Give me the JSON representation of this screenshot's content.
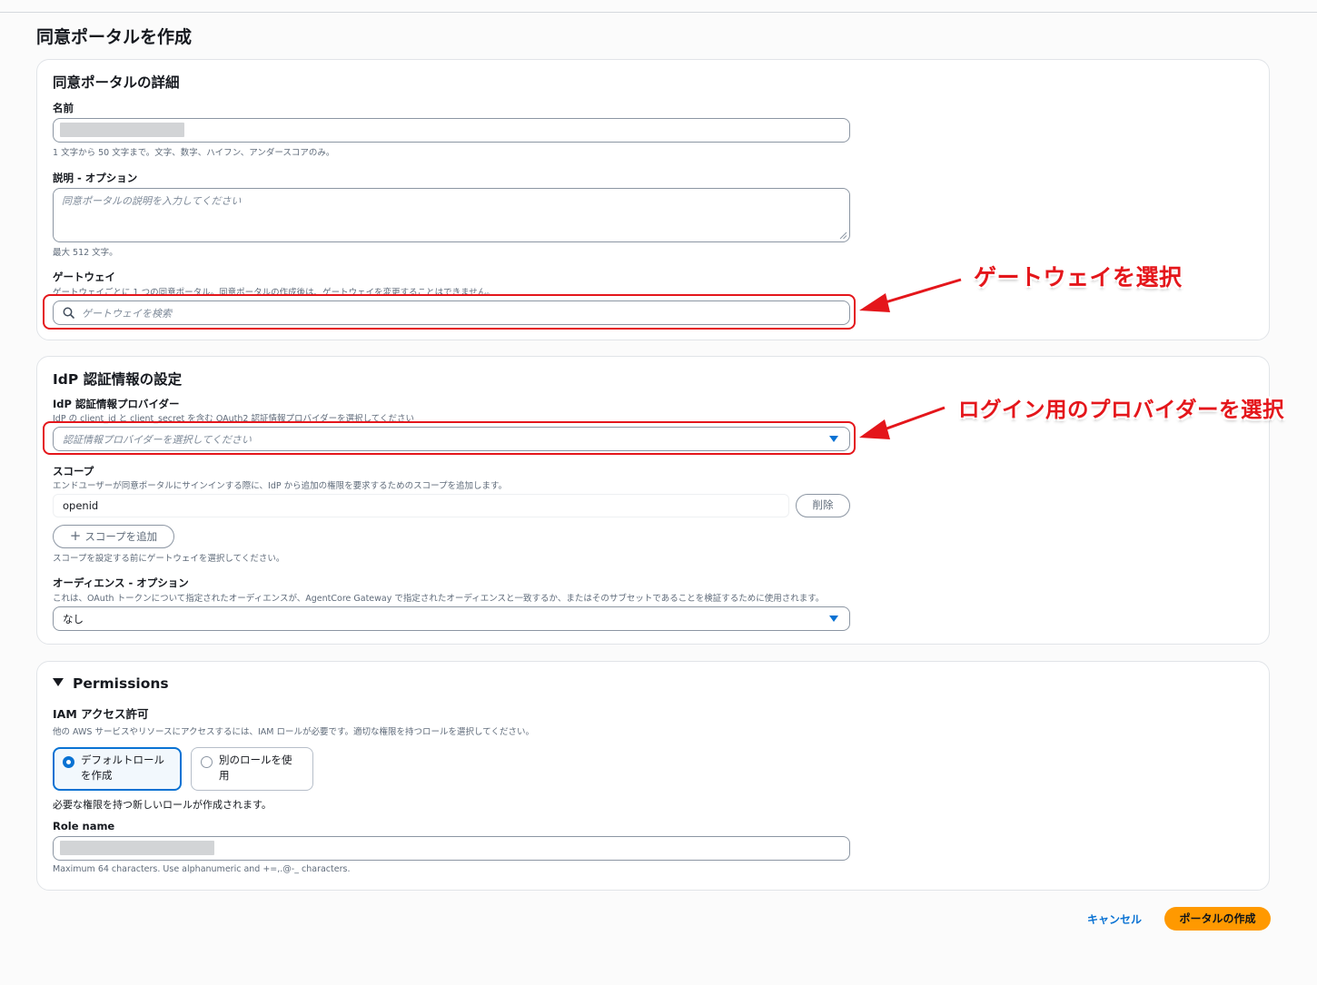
{
  "page_title": "同意ポータルを作成",
  "details": {
    "heading": "同意ポータルの詳細",
    "name_label": "名前",
    "name_hint": "1 文字から 50 文字まで。文字、数字、ハイフン、アンダースコアのみ。",
    "desc_label": "説明 - オプション",
    "desc_placeholder": "同意ポータルの説明を入力してください",
    "desc_hint": "最大 512 文字。",
    "gateway_label": "ゲートウェイ",
    "gateway_hint": "ゲートウェイごとに 1 つの同意ポータル。同意ポータルの作成後は、ゲートウェイを変更することはできません。",
    "gateway_placeholder": "ゲートウェイを検索"
  },
  "idp": {
    "heading": "IdP 認証情報の設定",
    "provider_label": "IdP 認証情報プロバイダー",
    "provider_hint": "IdP の client_id と client_secret を含む OAuth2 認証情報プロバイダーを選択してください",
    "provider_placeholder": "認証情報プロバイダーを選択してください",
    "scope_label": "スコープ",
    "scope_hint": "エンドユーザーが同意ポータルにサインインする際に、IdP から追加の権限を要求するためのスコープを追加します。",
    "scope_value": "openid",
    "delete_label": "削除",
    "add_scope_label": "スコープを追加",
    "add_scope_hint": "スコープを設定する前にゲートウェイを選択してください。",
    "audience_label": "オーディエンス - オプション",
    "audience_hint": "これは、OAuth トークンについて指定されたオーディエンスが、AgentCore Gateway で指定されたオーディエンスと一致するか、またはそのサブセットであることを検証するために使用されます。",
    "audience_value": "なし"
  },
  "permissions": {
    "heading": "Permissions",
    "iam_label": "IAM アクセス許可",
    "iam_hint": "他の AWS サービスやリソースにアクセスするには、IAM ロールが必要です。適切な権限を持つロールを選択してください。",
    "option_default_line1": "デフォルトロール",
    "option_default_line2": "を作成",
    "option_other_line1": "別のロールを使",
    "option_other_line2": "用",
    "selected_option": "デフォルトロールを作成",
    "role_note": "必要な権限を持つ新しいロールが作成されます。",
    "role_name_label": "Role name",
    "role_name_hint": "Maximum 64 characters. Use alphanumeric and +=,.@-_ characters."
  },
  "footer": {
    "cancel_label": "キャンセル",
    "create_label": "ポータルの作成"
  },
  "annotations": {
    "gateway_note": "ゲートウェイを選択",
    "provider_note": "ログイン用のプロバイダーを選択"
  },
  "colors": {
    "accent_blue": "#0972d3",
    "primary_orange": "#ff9900",
    "annotation_red": "#e4161b"
  }
}
